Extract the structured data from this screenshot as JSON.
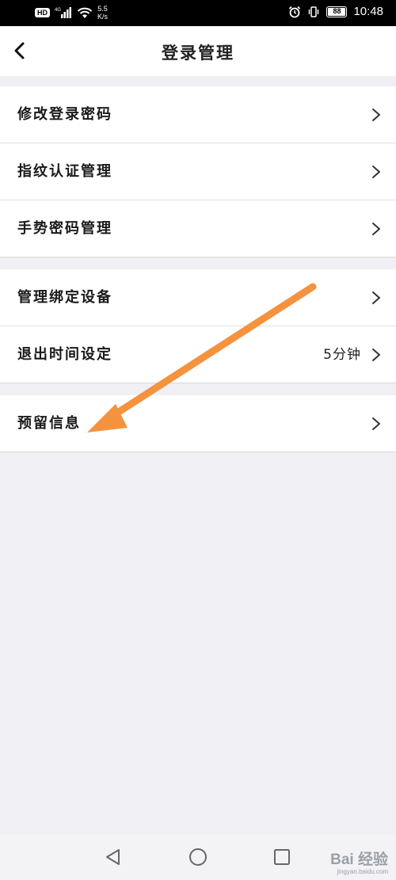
{
  "status_bar": {
    "hd": "HD",
    "net_type": "4G",
    "net_speed_value": "5.5",
    "net_speed_unit": "K/s",
    "battery": "88",
    "time": "10:48"
  },
  "header": {
    "title": "登录管理"
  },
  "groups": [
    {
      "items": [
        {
          "label": "修改登录密码"
        },
        {
          "label": "指纹认证管理"
        },
        {
          "label": "手势密码管理"
        }
      ]
    },
    {
      "items": [
        {
          "label": "管理绑定设备"
        },
        {
          "label": "退出时间设定",
          "value": "5分钟"
        }
      ]
    },
    {
      "items": [
        {
          "label": "预留信息"
        }
      ]
    }
  ],
  "annotation": {
    "arrow_color": "#f5923e"
  },
  "watermark": {
    "main": "Bai 经验",
    "sub": "jingyan.baidu.com"
  }
}
